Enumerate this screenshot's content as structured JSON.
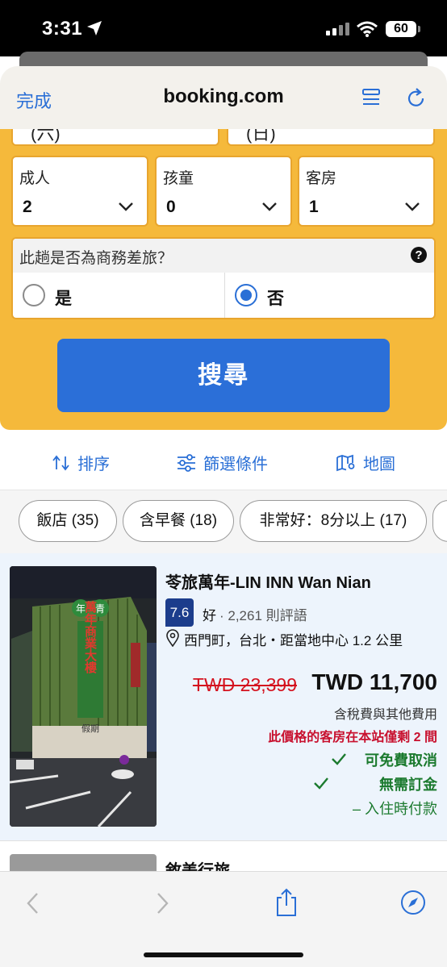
{
  "status": {
    "time": "3:31",
    "battery": "60"
  },
  "browser": {
    "done_label": "完成",
    "url": "booking.com"
  },
  "search": {
    "checkin_partial": "(六)",
    "checkout_partial": "(日)",
    "adults": {
      "label": "成人",
      "value": "2"
    },
    "children": {
      "label": "孩童",
      "value": "0"
    },
    "rooms": {
      "label": "客房",
      "value": "1"
    },
    "business_question": "此趟是否為商務差旅？",
    "yes_label": "是",
    "no_label": "否",
    "business_selected": "否",
    "search_button": "搜尋"
  },
  "toolbar": {
    "sort": "排序",
    "filter": "篩選條件",
    "map": "地圖"
  },
  "chips": [
    "飯店 (35)",
    "含早餐 (18)",
    "非常好：8分以上 (17)"
  ],
  "property": {
    "name": "苓旅萬年-LIN INN Wan Nian",
    "score": "7.6",
    "score_word": "好",
    "reviews": "· 2,261 則評語",
    "location": "西門町，台北・距當地中心 1.2 公里",
    "old_price": "TWD 23,399",
    "price": "TWD 11,700",
    "tax_note": "含稅費與其他費用",
    "scarcity": "此價格的客房在本站僅剩 2 間",
    "free_cancel": "可免費取消",
    "no_deposit": "無需訂金",
    "pay_at_property": "– 入住時付款",
    "photo_sign": "萬年商業大樓",
    "photo_sign_top": "年",
    "photo_sign_top2": "青",
    "photo_shop": "假期"
  },
  "next_property": {
    "name": "敘美行旅"
  },
  "colors": {
    "brand_yellow": "#f5b93b",
    "brand_blue": "#2b6fd8",
    "score_blue": "#1c3d8c",
    "green": "#1b7a2e",
    "red": "#c8102e"
  }
}
